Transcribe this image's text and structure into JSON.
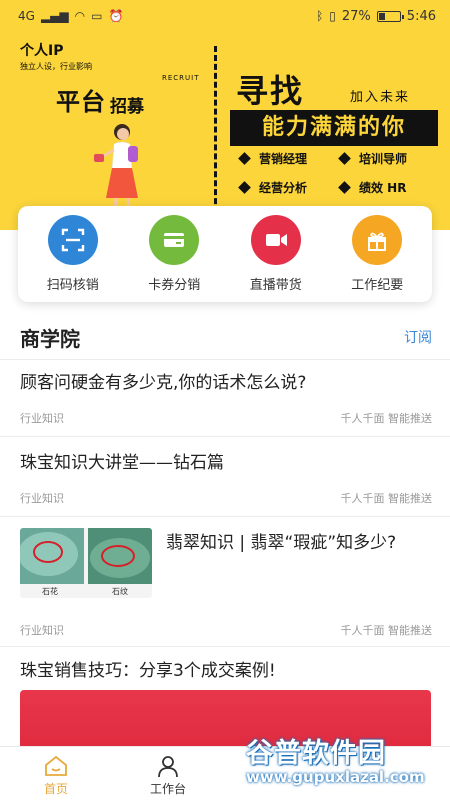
{
  "status_bar": {
    "network": "4G",
    "battery": "27%",
    "time": "5:46"
  },
  "banner": {
    "brand_title": "个人IP",
    "brand_sub": "独立人设，行业影响",
    "platform": "平台",
    "recruit_cn": "招募",
    "recruit_en": "RECRUIT",
    "seek": "寻找",
    "join": "加入未来",
    "capable": "能力满满的你",
    "roles": [
      "营销经理",
      "培训导师",
      "经营分析",
      "绩效 HR"
    ]
  },
  "quick_actions": [
    {
      "label": "扫码核销",
      "icon": "scan-icon",
      "color": "#2f86d6"
    },
    {
      "label": "卡券分销",
      "icon": "card-icon",
      "color": "#74bb3d"
    },
    {
      "label": "直播带货",
      "icon": "live-video-icon",
      "color": "#e5304a"
    },
    {
      "label": "工作纪要",
      "icon": "gift-box-icon",
      "color": "#f5a623"
    }
  ],
  "section": {
    "title": "商学院",
    "subscribe": "订阅"
  },
  "articles": [
    {
      "title": "顾客问硬金有多少克,你的话术怎么说?",
      "category": "行业知识",
      "tags": "千人千面 智能推送"
    },
    {
      "title": "珠宝知识大讲堂——钻石篇",
      "category": "行业知识",
      "tags": "千人千面 智能推送"
    },
    {
      "title": "翡翠知识 | 翡翠“瑕疵”知多少?",
      "category": "行业知识",
      "tags": "千人千面 智能推送",
      "thumb_captions": [
        "石花",
        "石纹"
      ]
    },
    {
      "title": "珠宝销售技巧：分享3个成交案例!"
    }
  ],
  "bottom_nav": [
    {
      "label": "首页",
      "icon": "home-icon",
      "active": true
    },
    {
      "label": "工作台",
      "icon": "person-icon",
      "active": false
    }
  ],
  "watermark": {
    "cn": "谷普软件园",
    "url": "www.gupuxlazal.com"
  },
  "colors": {
    "banner_yellow": "#fbd53a",
    "accent_blue": "#3a86d6",
    "nav_active": "#e6a93a"
  }
}
